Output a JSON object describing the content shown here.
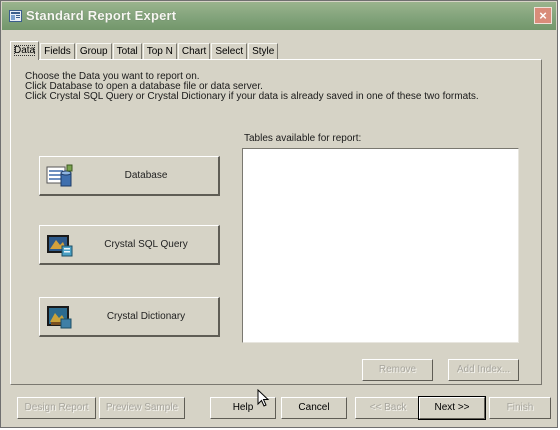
{
  "window": {
    "title": "Standard Report Expert",
    "close_glyph": "×"
  },
  "tabs": [
    {
      "label": "Data"
    },
    {
      "label": "Fields"
    },
    {
      "label": "Group"
    },
    {
      "label": "Total"
    },
    {
      "label": "Top N"
    },
    {
      "label": "Chart"
    },
    {
      "label": "Select"
    },
    {
      "label": "Style"
    }
  ],
  "instructions": {
    "line1": "Choose the Data you want to report on.",
    "line2": "Click Database to open a database file or data server.",
    "line3": "Click Crystal SQL Query or Crystal Dictionary if your data is already saved in one of these two formats."
  },
  "sources": {
    "database": {
      "label": "Database",
      "icon": "database-icon"
    },
    "sql_query": {
      "label": "Crystal SQL Query",
      "icon": "sql-query-icon"
    },
    "dictionary": {
      "label": "Crystal Dictionary",
      "icon": "dictionary-icon"
    }
  },
  "tables": {
    "label": "Tables available for report:",
    "items": []
  },
  "panel_buttons": {
    "remove": "Remove",
    "add_index": "Add Index..."
  },
  "footer_buttons": {
    "design_report": "Design Report",
    "preview_sample": "Preview Sample",
    "help": "Help",
    "cancel": "Cancel",
    "back": "<< Back",
    "next": "Next >>",
    "finish": "Finish"
  },
  "colors": {
    "titlebar": "#82a37b",
    "face": "#d6d3c6",
    "close": "#d98c7a"
  }
}
